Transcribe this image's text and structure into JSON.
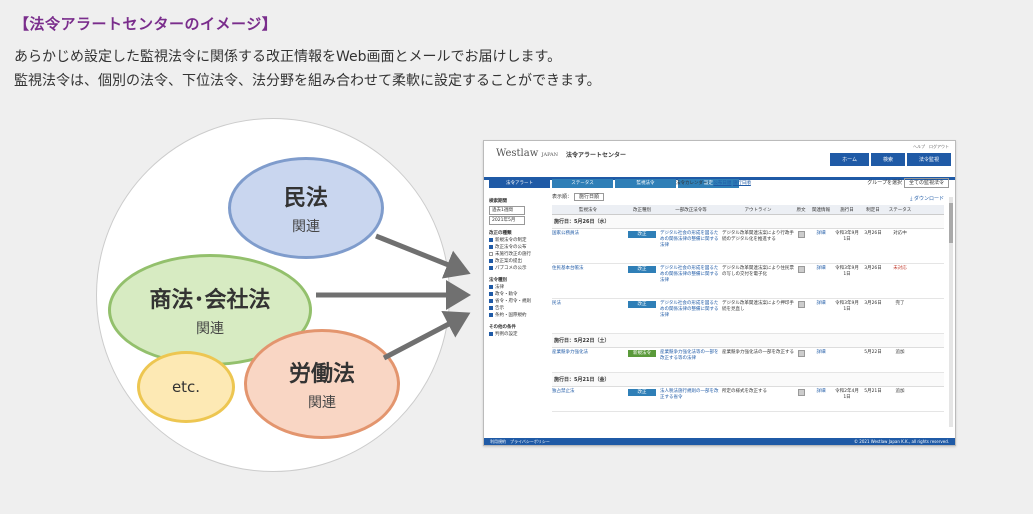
{
  "heading": "【法令アラートセンターのイメージ】",
  "lead": [
    "あらかじめ設定した監視法令に関係する改正情報をWeb画面とメールでお届けします。",
    "監視法令は、個別の法令、下位法令、法分野を組み合わせて柔軟に設定することができます。"
  ],
  "diagram": {
    "civil": {
      "main": "民法",
      "sub": "関連"
    },
    "commercial": {
      "main": "商法･会社法",
      "sub": "関連"
    },
    "labor": {
      "main": "労働法",
      "sub": "関連"
    },
    "etc": {
      "main": "etc."
    }
  },
  "colors": {
    "accent_purple": "#7a2d8c",
    "app_blue": "#1f5aa6",
    "arrow_gray": "#707070"
  },
  "screen": {
    "logo": "Westlaw",
    "logo_suffix": "JAPAN",
    "app_title": "法令アラートセンター",
    "utility": "ヘルプ　ログアウト",
    "main_nav": [
      "ホーム",
      "検索",
      "法令監視"
    ],
    "tabs": [
      "法令アラート",
      "ステータス",
      "監視法令",
      "設定"
    ],
    "calendar_label": "法令カレンダー：",
    "calendar_links": [
      "公布日順",
      "施行日順"
    ],
    "group_label": "グループを選択",
    "group_value": "全ての監視法令",
    "download": "ダウンロード",
    "filter_label": "表示順：",
    "filter_value": "施行日順",
    "side": {
      "period_label": "検索期間",
      "period_values": [
        "過去1週間",
        "2021年5月"
      ],
      "kind_label": "改正の種類",
      "kind_items": [
        {
          "label": "新規法令の制定",
          "on": true
        },
        {
          "label": "改正法令の公布",
          "on": true
        },
        {
          "label": "未施行改正の施行",
          "on": false
        },
        {
          "label": "改正案の提出",
          "on": true
        },
        {
          "label": "パブコメの公示",
          "on": true
        }
      ],
      "law_label": "法令種別",
      "law_items": [
        "法律",
        "政令・勅令",
        "省令・府令・規則",
        "告示",
        "条約・国際規約"
      ],
      "other_label": "その他の条件",
      "other_items": [
        "判例の設定"
      ]
    },
    "columns": [
      "監視法令",
      "改正種別",
      "一部改正法令等",
      "アウトライン",
      "原文",
      "関連情報",
      "施行日",
      "制定日",
      "ステータス"
    ],
    "groups": [
      {
        "title": "施行日：5月26日（水）",
        "rows": [
          {
            "law": "国家公務員法",
            "kind": "改正",
            "amend": "デジタル社会の形成を図るための関係法律の整備に関する法律",
            "outline": "デジタル改革関連法案により行政手続のデジタル化を推進する",
            "effective": "令和3年9月1日",
            "date": "3月26日",
            "status": "対応中"
          },
          {
            "law": "住民基本台帳法",
            "kind": "改正",
            "amend": "デジタル社会の形成を図るための関係法律の整備に関する法律",
            "outline": "デジタル改革関連法案により住民票の写しの交付を電子化",
            "effective": "令和3年9月1日",
            "date": "3月26日",
            "status": "未対応"
          },
          {
            "law": "民法",
            "kind": "改正",
            "amend": "デジタル社会の形成を図るための関係法律の整備に関する法律",
            "outline": "デジタル改革関連法案により押印手続を見直し",
            "effective": "令和3年9月1日",
            "date": "3月26日",
            "status": "完了"
          }
        ]
      },
      {
        "title": "施行日：5月22日（土）",
        "rows": [
          {
            "law": "産業競争力強化法",
            "kind": "新規法令",
            "amend": "産業競争力強化法等の一部を改正する等の法律",
            "outline": "産業競争力強化法の一部を改正する",
            "effective": "",
            "date": "5月22日",
            "status": "追加"
          }
        ]
      },
      {
        "title": "施行日：5月21日（金）",
        "rows": [
          {
            "law": "独占禁止法",
            "kind": "改正",
            "amend": "法人税法施行規則の一部を改正する省令",
            "outline": "所定の様式を改正する",
            "effective": "令和2年4月1日",
            "date": "5月21日",
            "status": "追加"
          }
        ]
      }
    ],
    "footer_left": "利用規約　プライバシーポリシー",
    "footer_right": "© 2021 Westlaw Japan K.K., all rights reserved."
  }
}
